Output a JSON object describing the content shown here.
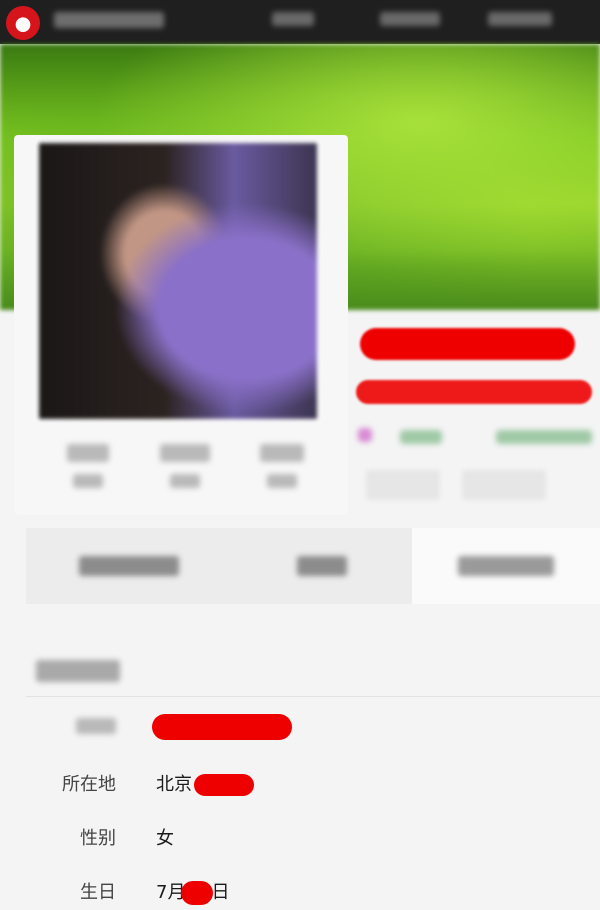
{
  "profile": {
    "info": {
      "location_label": "所在地",
      "location_value": "北京",
      "gender_label": "性别",
      "gender_value": "女",
      "birthday_label": "生日",
      "birthday_month": "7月",
      "birthday_suffix": "日"
    }
  },
  "colors": {
    "redaction": "#ee0000",
    "banner_green": "#79c51f",
    "topbar": "#1f1f1f"
  }
}
